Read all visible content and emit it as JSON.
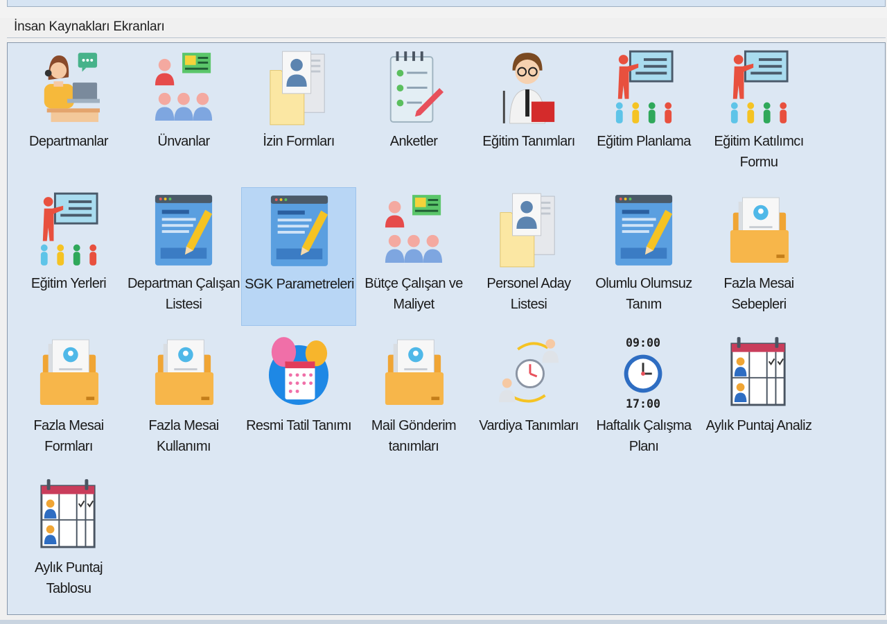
{
  "group_title": "İnsan Kaynakları Ekranları",
  "colors": {
    "panel_bg": "#dce7f3",
    "selected_bg": "#b8d6f5"
  },
  "tiles": [
    {
      "label": "Departmanlar",
      "icon": "receptionist-icon"
    },
    {
      "label": "Ünvanlar",
      "icon": "org-chart-icon"
    },
    {
      "label": "İzin Formları",
      "icon": "document-profile-icon"
    },
    {
      "label": "Anketler",
      "icon": "survey-checklist-icon"
    },
    {
      "label": "Eğitim Tanımları",
      "icon": "teacher-book-icon"
    },
    {
      "label": "Eğitim Planlama",
      "icon": "training-presentation-icon"
    },
    {
      "label": "Eğitim Katılımcı\nFormu",
      "icon": "training-presentation-icon"
    },
    {
      "label": "Eğitim Yerleri",
      "icon": "training-presentation-icon"
    },
    {
      "label": "Departman Çalışan\nListesi",
      "icon": "edit-window-icon"
    },
    {
      "label": "SGK Parametreleri",
      "icon": "edit-window-icon",
      "selected": true
    },
    {
      "label": "Bütçe Çalışan ve\nMaliyet",
      "icon": "org-chart-icon"
    },
    {
      "label": "Personel Aday\nListesi",
      "icon": "document-profile-icon"
    },
    {
      "label": "Olumlu Olumsuz\nTanım",
      "icon": "edit-window-icon"
    },
    {
      "label": "Fazla Mesai\nSebepleri",
      "icon": "folder-profile-icon"
    },
    {
      "label": "Fazla Mesai\nFormları",
      "icon": "folder-profile-icon"
    },
    {
      "label": "Fazla Mesai\nKullanımı",
      "icon": "folder-profile-icon"
    },
    {
      "label": "Resmi Tatil Tanımı",
      "icon": "holiday-calendar-icon"
    },
    {
      "label": "Mail Gönderim\ntanımları",
      "icon": "folder-profile-icon"
    },
    {
      "label": "Vardiya Tanımları",
      "icon": "shift-rotation-icon"
    },
    {
      "label": "Haftalık Çalışma\nPlanı",
      "icon": "work-hours-clock-icon",
      "clock_top": "09:00",
      "clock_bottom": "17:00"
    },
    {
      "label": "Aylık Puntaj Analiz",
      "icon": "attendance-calendar-icon"
    },
    {
      "label": "Aylık Puntaj\nTablosu",
      "icon": "attendance-calendar-icon"
    }
  ]
}
